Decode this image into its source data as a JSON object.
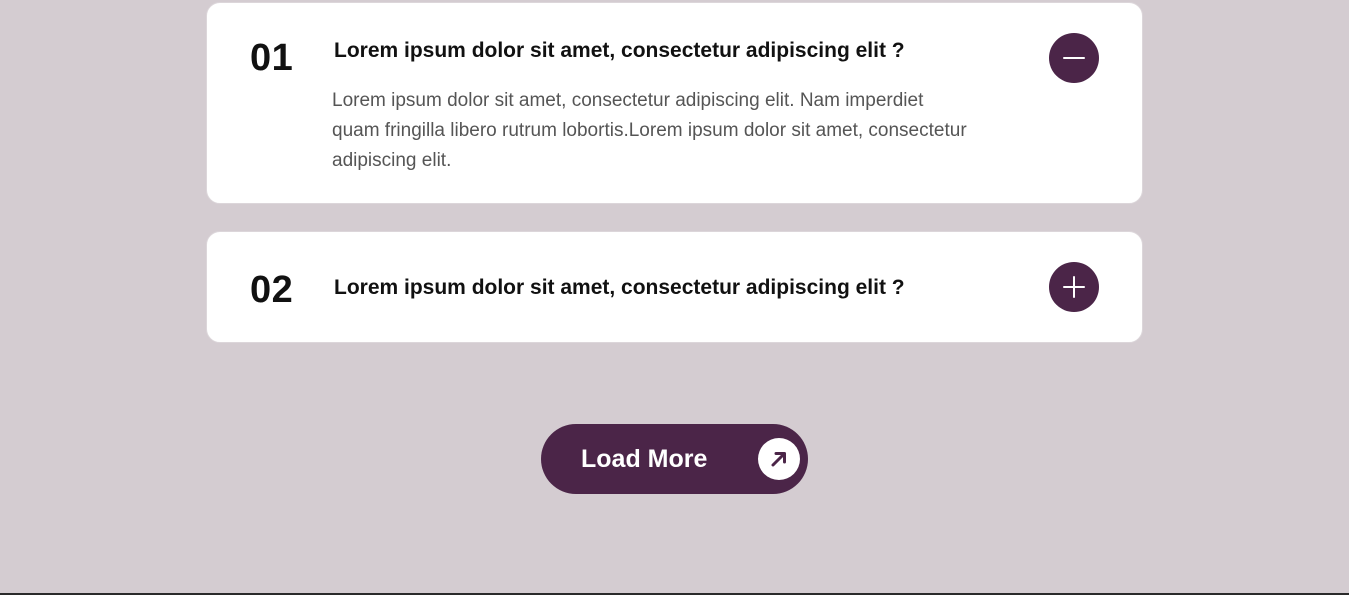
{
  "faq": {
    "items": [
      {
        "number": "01",
        "question": "Lorem ipsum dolor sit amet, consectetur adipiscing elit ?",
        "answer": "Lorem ipsum dolor sit amet, consectetur adipiscing elit. Nam imperdiet quam fringilla libero rutrum lobortis.Lorem ipsum dolor sit amet, consectetur adipiscing elit.",
        "expanded": true,
        "toggle_icon": "minus-icon"
      },
      {
        "number": "02",
        "question": "Lorem ipsum dolor sit amet, consectetur adipiscing elit ?",
        "expanded": false,
        "toggle_icon": "plus-icon"
      }
    ]
  },
  "load_more": {
    "label": "Load More",
    "icon": "arrow-up-right-icon"
  },
  "colors": {
    "background": "#d4ccd1",
    "accent": "#4b2548",
    "card": "#ffffff"
  }
}
